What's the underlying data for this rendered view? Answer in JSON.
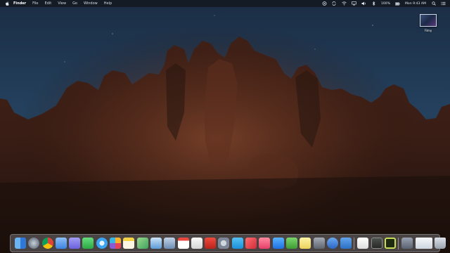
{
  "menubar": {
    "apple_icon": "apple-logo-icon",
    "app_name": "Finder",
    "menus": [
      "File",
      "Edit",
      "View",
      "Go",
      "Window",
      "Help"
    ],
    "status": {
      "icons": [
        "creative-cloud-icon",
        "sync-icon",
        "wifi-icon",
        "airplay-icon",
        "volume-icon",
        "bluetooth-icon"
      ],
      "battery_text": "100%",
      "clock": "Mon 9:43 AM",
      "trailing_icons": [
        "search-icon",
        "notification-center-icon"
      ]
    }
  },
  "desktop": {
    "icons": [
      {
        "label": "Filmy",
        "icon": "screenshot-file-icon"
      }
    ]
  },
  "dock": {
    "apps": [
      {
        "name": "finder",
        "icon": "finder-icon",
        "color": "#3d8ee6"
      },
      {
        "name": "launchpad",
        "icon": "launchpad-icon",
        "color": "#7d8897"
      },
      {
        "name": "chrome",
        "icon": "chrome-icon",
        "color": "#e9b53b"
      },
      {
        "name": "mail",
        "icon": "mail-icon",
        "color": "#4f8fe8"
      },
      {
        "name": "messages",
        "icon": "messages-icon",
        "color": "#7a74e6"
      },
      {
        "name": "facetime",
        "icon": "facetime-icon",
        "color": "#37c24f"
      },
      {
        "name": "safari",
        "icon": "safari-icon",
        "color": "#3aa4f2"
      },
      {
        "name": "photos",
        "icon": "photos-icon",
        "color": "#eeeeee"
      },
      {
        "name": "notes",
        "icon": "notes-icon",
        "color": "#f1cf3b"
      },
      {
        "name": "maps",
        "icon": "maps-icon",
        "color": "#4fc06f"
      },
      {
        "name": "preview",
        "icon": "preview-icon",
        "color": "#6aa8df"
      },
      {
        "name": "xcode",
        "icon": "xcode-icon",
        "color": "#8aa7c8"
      },
      {
        "name": "calendar",
        "icon": "calendar-icon",
        "color": "#ffffff"
      },
      {
        "name": "textedit",
        "icon": "textedit-icon",
        "color": "#e4e4e4"
      },
      {
        "name": "acrobat",
        "icon": "acrobat-icon",
        "color": "#d8342c"
      },
      {
        "name": "system-preferences",
        "icon": "system-preferences-icon",
        "color": "#8c96a6"
      },
      {
        "name": "skype",
        "icon": "skype-icon",
        "color": "#2aa5e8"
      },
      {
        "name": "news",
        "icon": "news-icon",
        "color": "#e5464f"
      },
      {
        "name": "music",
        "icon": "music-icon",
        "color": "#f35c7a"
      },
      {
        "name": "app-store",
        "icon": "app-store-icon",
        "color": "#2f8ef5"
      },
      {
        "name": "evernote",
        "icon": "evernote-icon",
        "color": "#57b649"
      },
      {
        "name": "stickies",
        "icon": "stickies-icon",
        "color": "#f3e27e"
      },
      {
        "name": "automator",
        "icon": "automator-icon",
        "color": "#7f858f"
      },
      {
        "name": "vpn",
        "icon": "vpn-shield-icon",
        "color": "#3a7dd7"
      },
      {
        "name": "trello",
        "icon": "trello-icon",
        "color": "#3f86d9"
      }
    ],
    "extras": [
      {
        "name": "pages",
        "icon": "pages-icon",
        "color": "#f5f5f5"
      },
      {
        "name": "terminal",
        "icon": "terminal-icon",
        "color": "#363a36"
      },
      {
        "name": "activity-monitor",
        "icon": "activity-monitor-icon",
        "color": "#bcd34a"
      }
    ],
    "right": [
      {
        "name": "downloads",
        "icon": "downloads-stack-icon",
        "color": "#6f7788"
      },
      {
        "name": "screenshots",
        "icon": "screenshots-stack-icon",
        "color": "#e5e8ed"
      },
      {
        "name": "trash",
        "icon": "trash-icon",
        "color": "#b9c0cb"
      }
    ]
  }
}
